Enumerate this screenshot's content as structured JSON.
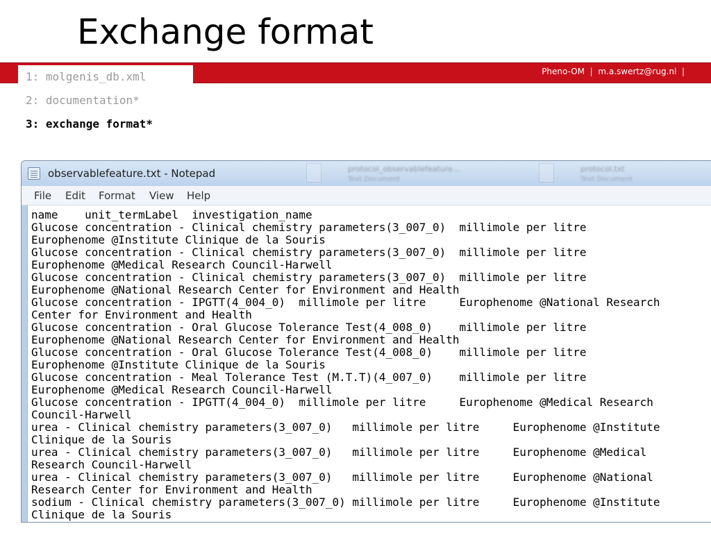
{
  "slide": {
    "title": "Exchange format",
    "menu": [
      "1: molgenis_db.xml",
      "2: documentation*",
      "3: exchange format*"
    ],
    "footer": "Pheno-OM  |  m.a.swertz@rug.nl  |"
  },
  "window": {
    "title": "observablefeature.txt - Notepad",
    "background_tabs": [
      {
        "title": "protocol_observablefeature...",
        "subtitle": "Text Document"
      },
      {
        "title": "protocol.txt",
        "subtitle": "Text Document"
      }
    ],
    "menu": {
      "file": "File",
      "edit": "Edit",
      "format": "Format",
      "view": "View",
      "help": "Help"
    }
  },
  "content": {
    "lines": [
      "name    unit_termLabel  investigation_name",
      "Glucose concentration - Clinical chemistry parameters(3_007_0)  millimole per litre",
      "Europhenome @Institute Clinique de la Souris",
      "Glucose concentration - Clinical chemistry parameters(3_007_0)  millimole per litre",
      "Europhenome @Medical Research Council-Harwell",
      "Glucose concentration - Clinical chemistry parameters(3_007_0)  millimole per litre",
      "Europhenome @National Research Center for Environment and Health",
      "Glucose concentration - IPGTT(4_004_0)  millimole per litre     Europhenome @National Research",
      "Center for Environment and Health",
      "Glucose concentration - Oral Glucose Tolerance Test(4_008_0)    millimole per litre",
      "Europhenome @National Research Center for Environment and Health",
      "Glucose concentration - Oral Glucose Tolerance Test(4_008_0)    millimole per litre",
      "Europhenome @Institute Clinique de la Souris",
      "Glucose concentration - Meal Tolerance Test (M.T.T)(4_007_0)    millimole per litre",
      "Europhenome @Medical Research Council-Harwell",
      "Glucose concentration - IPGTT(4_004_0)  millimole per litre     Europhenome @Medical Research",
      "Council-Harwell",
      "urea - Clinical chemistry parameters(3_007_0)   millimole per litre     Europhenome @Institute",
      "Clinique de la Souris",
      "urea - Clinical chemistry parameters(3_007_0)   millimole per litre     Europhenome @Medical",
      "Research Council-Harwell",
      "urea - Clinical chemistry parameters(3_007_0)   millimole per litre     Europhenome @National",
      "Research Center for Environment and Health",
      "sodium - Clinical chemistry parameters(3_007_0) millimole per litre     Europhenome @Institute",
      "Clinique de la Souris"
    ]
  }
}
